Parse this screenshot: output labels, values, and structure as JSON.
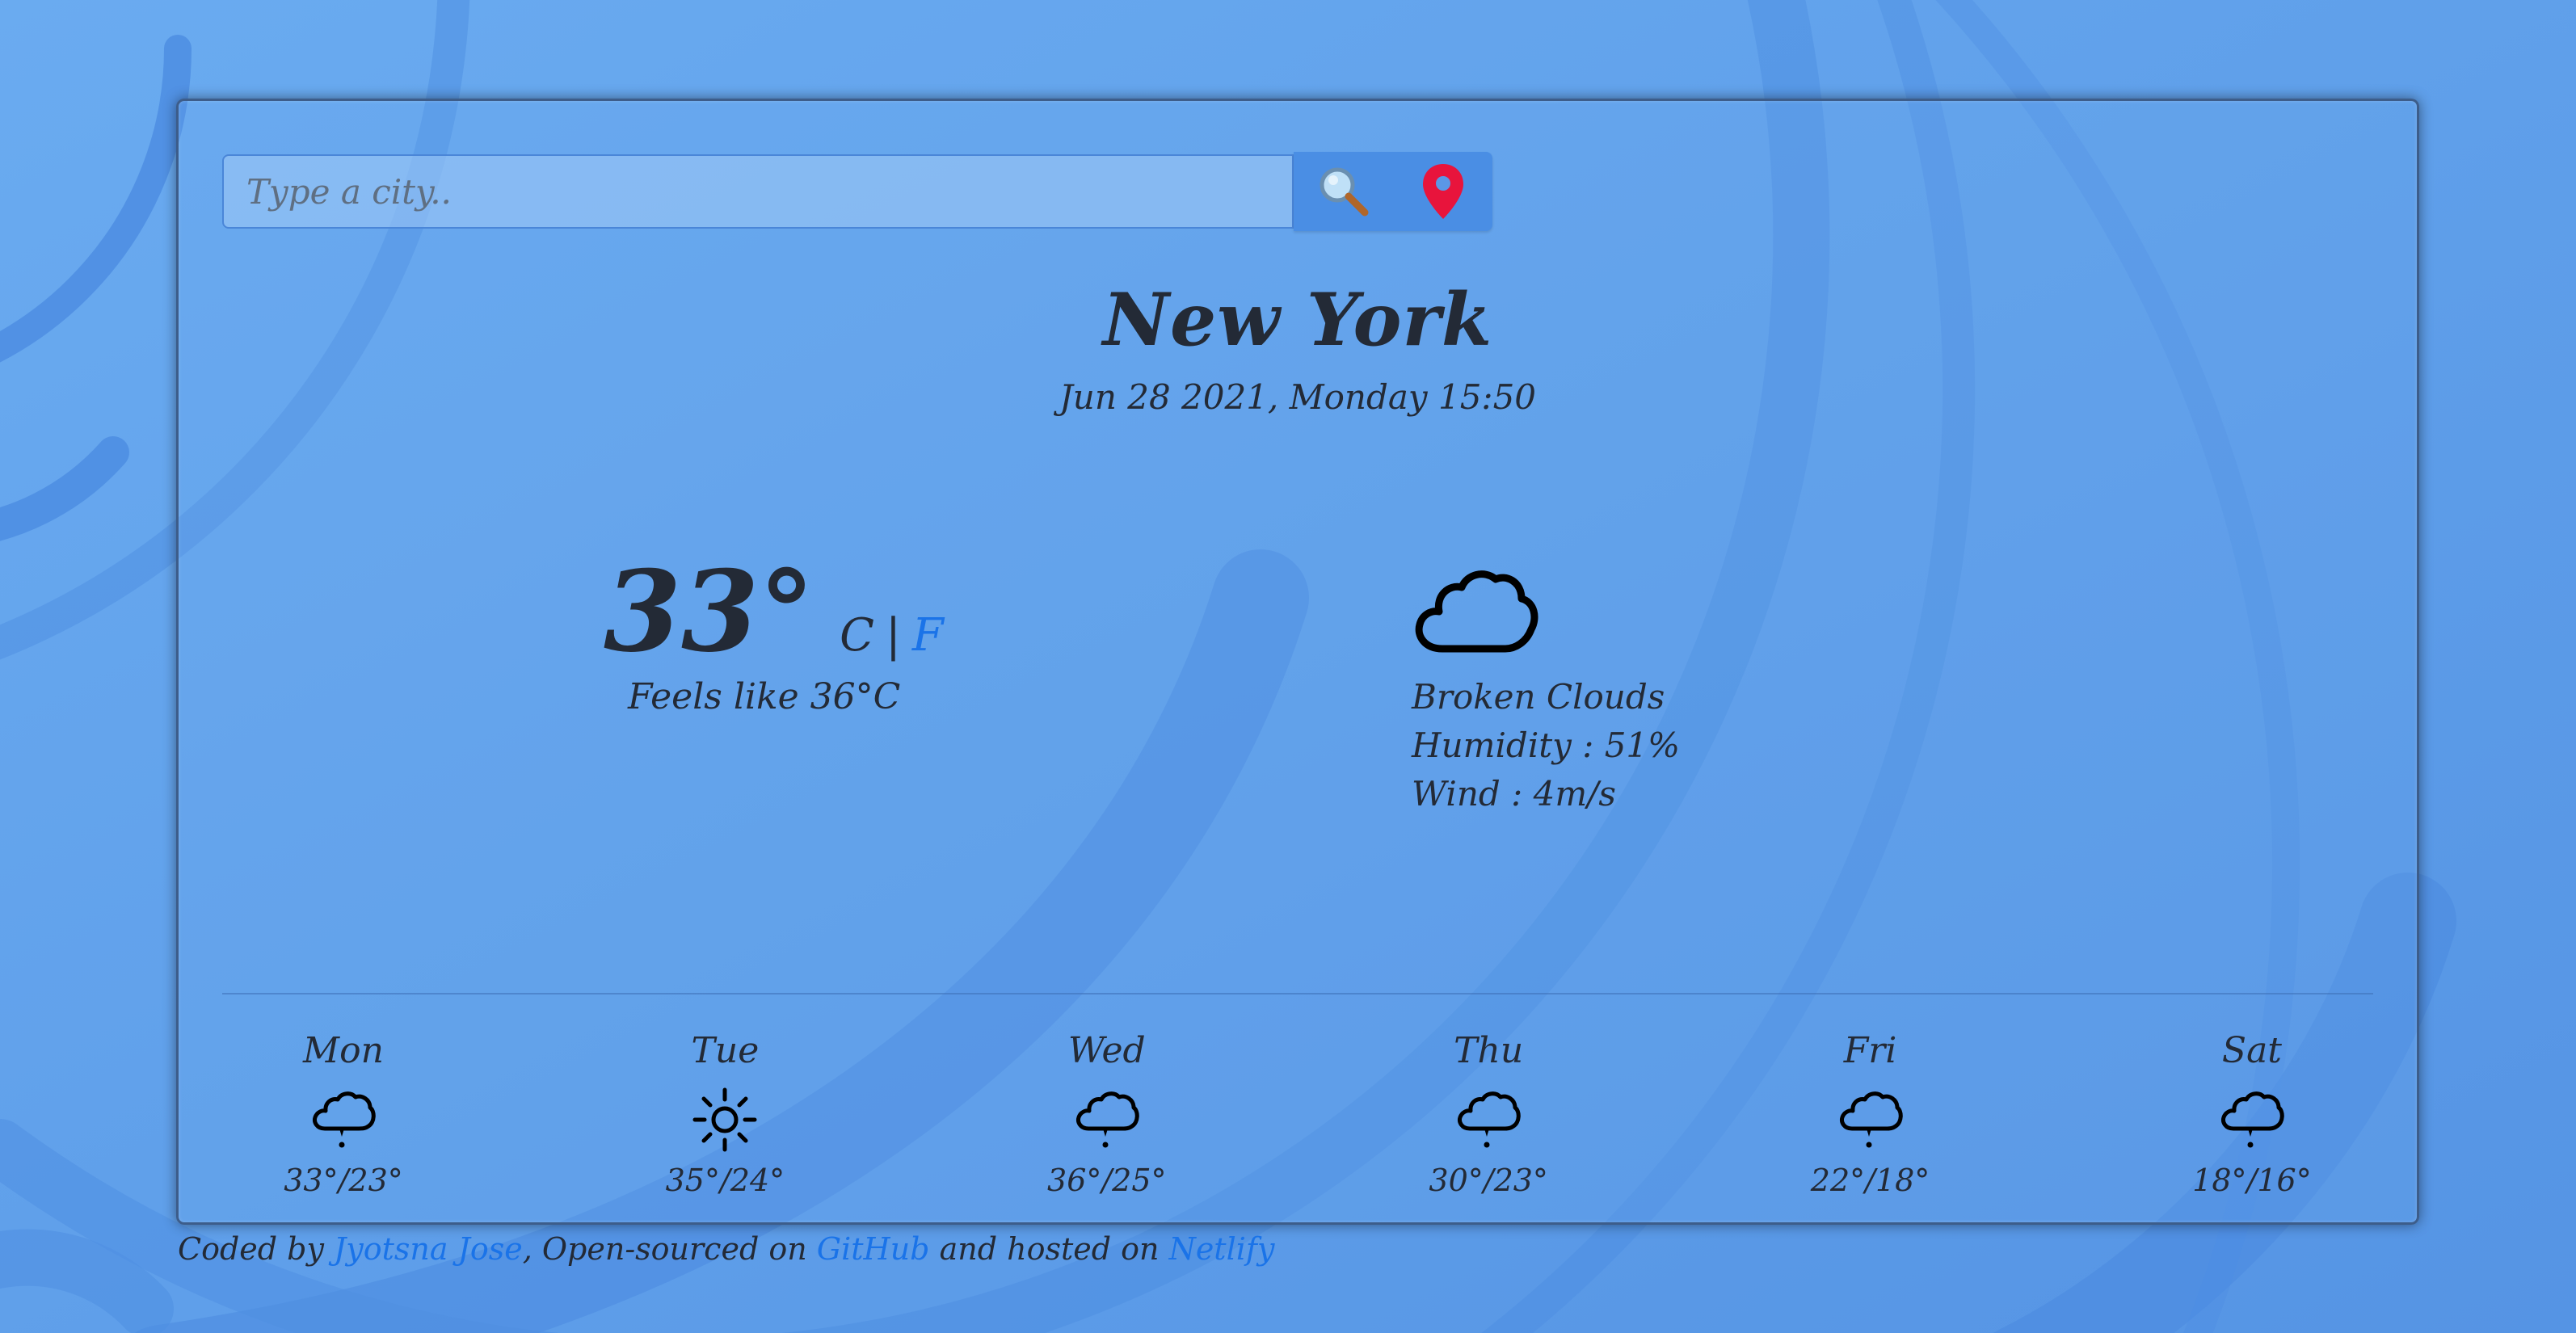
{
  "search": {
    "placeholder": "Type a city..",
    "value": ""
  },
  "icons": {
    "search": "magnifier-icon",
    "location": "location-pin-icon",
    "current_condition": "cloud-icon"
  },
  "current": {
    "city": "New York",
    "datetime": "Jun 28 2021, Monday 15:50",
    "temperature": "33°",
    "unit_c": "C",
    "unit_separator": "|",
    "unit_f": "F",
    "feels_like": "Feels like 36°C",
    "condition": "Broken Clouds",
    "humidity": "Humidity : 51%",
    "wind": "Wind : 4m/s"
  },
  "forecast": [
    {
      "day": "Mon",
      "icon": "rain-cloud-icon",
      "temp": "33°/23°"
    },
    {
      "day": "Tue",
      "icon": "sun-icon",
      "temp": "35°/24°"
    },
    {
      "day": "Wed",
      "icon": "rain-cloud-icon",
      "temp": "36°/25°"
    },
    {
      "day": "Thu",
      "icon": "rain-cloud-icon",
      "temp": "30°/23°"
    },
    {
      "day": "Fri",
      "icon": "rain-cloud-icon",
      "temp": "22°/18°"
    },
    {
      "day": "Sat",
      "icon": "rain-cloud-icon",
      "temp": "18°/16°"
    }
  ],
  "footer": {
    "prefix": "Coded by ",
    "author": "Jyotsna Jose",
    "middle": ", Open-sourced on ",
    "github": "GitHub",
    "middle2": " and hosted on ",
    "netlify": "Netlify"
  },
  "colors": {
    "background": "#5fa0ea",
    "accent_link": "#1a73e8",
    "text": "#232a36",
    "pin": "#e8143c"
  }
}
